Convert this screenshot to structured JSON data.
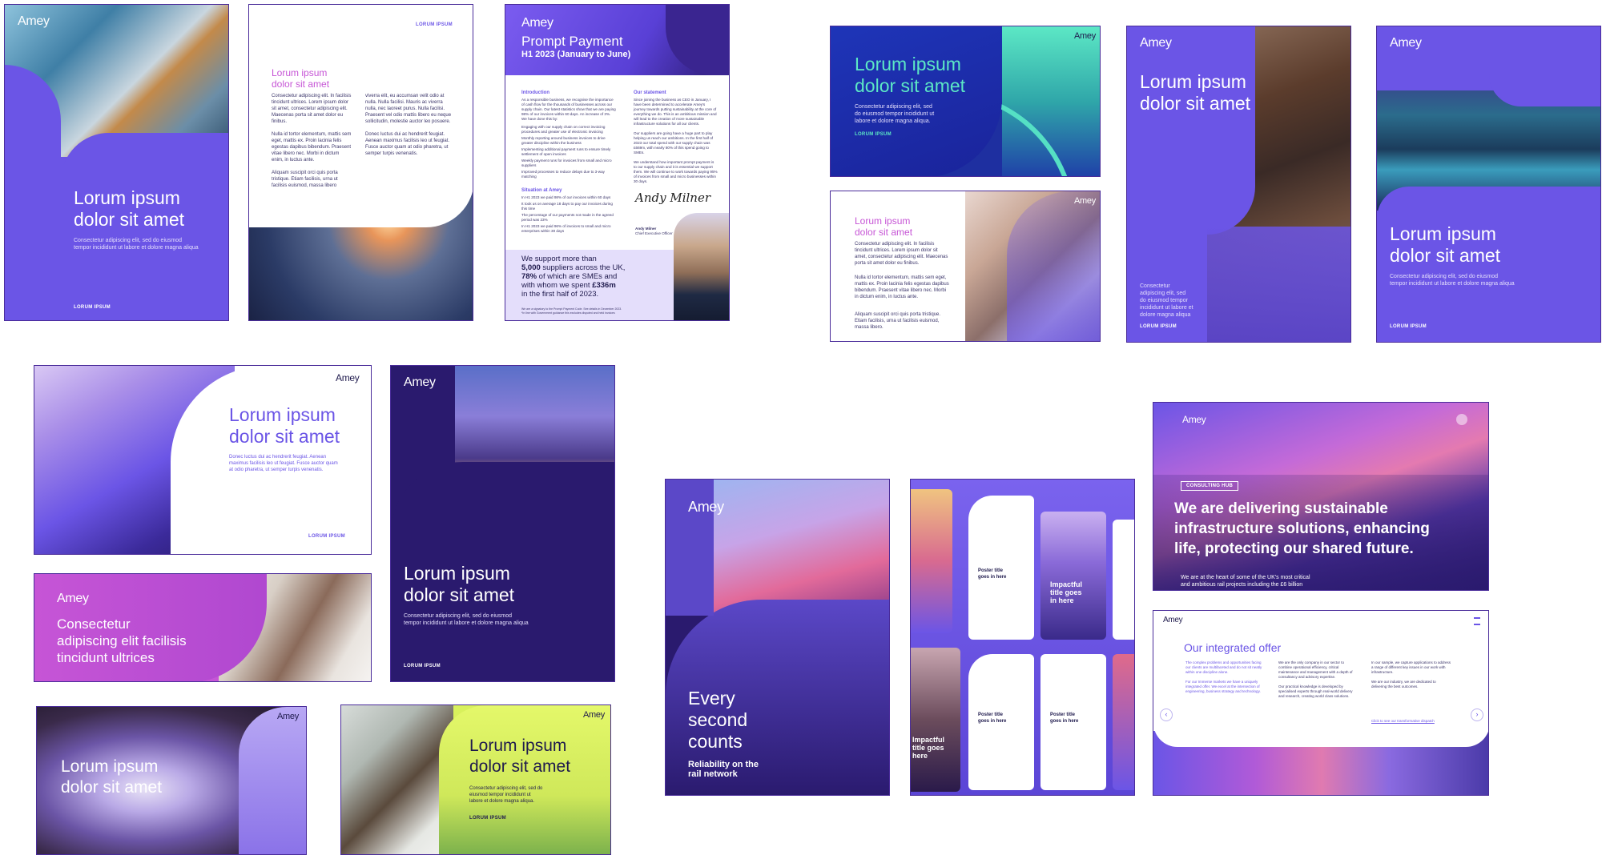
{
  "brand": "Amey",
  "cards": {
    "c1": {
      "title": "Lorum ipsum\ndolor sit amet",
      "sub": "Consectetur adipiscing elit, sed do eiusmod\ntempor incididunt ut labore et dolore magna aliqua",
      "tag": "LORUM IPSUM"
    },
    "c2": {
      "tag": "LORUM IPSUM",
      "title": "Lorum ipsum\ndolor sit amet",
      "col1": "Consectetur adipiscing elit. In facilisis tincidunt ultrices. Lorem ipsum dolor sit amet, consectetur adipiscing elit. Maecenas porta sit amet dolor eu finibus.\n\nNulla id tortor elementum, mattis sem eget, mattis ex. Proin lacinia felis egestas dapibus bibendum. Praesent vitae libero nec. Morbi in dictum enim, in luctus ante.\n\nAliquam suscipit orci quis porta tristique. Etiam facilisis, urna ut facilisis euismod, massa libero",
      "col2": "viverra elit, eu accumsan velit odio at nulla. Nulla facilisi. Mauris ac viverra nulla, nec laoreet purus. Nulla facilisi. Praesent vel odio mattis libero eu neque sollicitudin, molestie auctor leo posuere.\n\nDonec luctus dui ac hendrerit feugiat. Aenean maximus facilisis leo ut feugiat. Fusce auctor quam at odio pharetra, ut semper turpis venenatis."
    },
    "c3": {
      "title": "Prompt Payment",
      "subtitle": "H1 2023 (January to June)",
      "intro_h": "Introduction",
      "statement_h": "Our statement",
      "situation_h": "Situation at Amey",
      "intro": "As a responsible business, we recognise the importance of cash flow for the thousands of businesses across our supply chain. Our latest statistics show that we are paying 98% of our invoices within 60 days. An increase of 3%. We have done this by:",
      "bullets": [
        "Engaging with our supply chain on correct invoicing procedures and greater use of electronic invoicing",
        "Monthly reporting around business invoices to drive greater discipline within the business",
        "Implementing additional payment runs to ensure timely settlement of open invoices",
        "Weekly payment runs for invoices from small and micro suppliers",
        "Improved processes to reduce delays due to 3-way matching"
      ],
      "situation": [
        "In H1 2023 we paid 98% of our invoices within 60 days",
        "It took us on average 18 days to pay our invoices during this time",
        "The percentage of our payments not made in the agreed period was 23%",
        "In H1 2023 we paid 96% of invoices to small and micro enterprises within 30 days"
      ],
      "statement": "Since joining the business as CEO in January, I have been determined to accelerate Amey's journey towards putting sustainability at the core of everything we do. This is an ambitious mission and will lead to the creation of more sustainable infrastructure solutions for all our clients.\n\nOur suppliers are going have a huge part to play helping us reach our ambitions. In the first half of 2023 our total spend with our supply chain was £669m, with nearly 80% of this spend going to SMEs.\n\nWe understand how important prompt payment is to our supply chain and it is essential we support them. We will continue to work towards paying 95% of invoices from small and micro businesses within 30 days.",
      "signature": "Andy Milner",
      "sig_name": "Andy Milner",
      "sig_role": "Chief Executive Officer",
      "banner": [
        [
          "We support more than",
          false
        ],
        [
          "5,000",
          true
        ],
        [
          " suppliers across the UK,",
          false
        ],
        [
          "78%",
          true
        ],
        [
          " of which are SMEs and",
          false
        ],
        [
          "with whom we spent ",
          false
        ],
        [
          "£336m",
          true
        ],
        [
          "in the first half of 2023.",
          false
        ]
      ],
      "foot": "We are a signatory to the Prompt Payment Code. See details in December 2023.\n*In line with Government guidance this excludes disputed and held invoices"
    },
    "c4": {
      "title": "Lorum ipsum\ndolor sit amet",
      "sub": "Consectetur adipiscing elit, sed\ndo eiusmod tempor incididunt ut\nlabore et dolore magna aliqua.",
      "tag": "LORUM IPSUM"
    },
    "c5": {
      "title": "Lorum ipsum\ndolor sit amet",
      "p1": "Consectetur adipiscing elit. In facilisis tincidunt ultrices. Lorem ipsum dolor sit amet, consectetur adipiscing elit. Maecenas porta sit amet dolor eu finibus.",
      "p2": "Nulla id tortor elementum, mattis sem eget, mattis ex. Proin lacinia felis egestas dapibus bibendum. Praesent vitae libero nec. Morbi in dictum enim, in luctus ante.",
      "p3": "Aliquam suscipit orci quis porta tristique. Etiam facilisis, urna ut facilisis euismod, massa libero."
    },
    "c6": {
      "title": "Lorum ipsum\ndolor sit amet",
      "sub": "Consectetur\nadipiscing elit, sed\ndo eiusmod tempor\nincididunt ut labore et\ndolore magna aliqua",
      "tag": "LORUM IPSUM"
    },
    "c7": {
      "title": "Lorum ipsum\ndolor sit amet",
      "sub": "Consectetur adipiscing elit, sed do eiusmod\ntempor incididunt ut labore et dolore magna aliqua",
      "tag": "LORUM IPSUM"
    },
    "c8": {
      "title": "Lorum ipsum\ndolor sit amet",
      "sub": "Donec luctus dui ac hendrerit feugiat. Aenean\nmaximus facilisis leo ut feugiat. Fusce auctor quam\nat odio pharetra, ut semper turpis venenatis.",
      "tag": "LORUM IPSUM"
    },
    "c9": {
      "title": "Lorum ipsum\ndolor sit amet",
      "sub": "Consectetur adipiscing elit, sed do eiusmod\ntempor incididunt ut labore et dolore magna aliqua",
      "tag": "LORUM IPSUM"
    },
    "c10": {
      "title": "Consectetur\nadipiscing elit facilisis\ntincidunt ultrices"
    },
    "c11": {
      "title": "Lorum ipsum\ndolor sit amet"
    },
    "c12": {
      "title": "Lorum ipsum\ndolor sit amet",
      "sub": "Consectetur adipiscing elit, sed do\neiusmod tempor incididunt ut\nlabore et dolore magna aliqua.",
      "tag": "LORUM IPSUM"
    },
    "c13": {
      "title": "Every\nsecond\ncounts",
      "sub": "Reliability on the\nrail network"
    },
    "c14": {
      "posters": [
        "Poster title\ngoes in here",
        "Impactful\ntitle goes\nin here",
        "Poster title\ngoes in here",
        "Poster title\ngoes in here",
        "Impactful\ntitle goes\nhere"
      ]
    },
    "c15": {
      "badge": "CONSULTING HUB",
      "title": "We are delivering sustainable\ninfrastructure solutions, enhancing\nlife, protecting our shared future.",
      "sub": "We are at the heart of some of the UK's most critical\nand ambitious rail projects including the £6 billion"
    },
    "c16": {
      "title": "Our integrated offer",
      "col1": "The complex problems and opportunities facing our clients are multifaceted and do not sit neatly within one discipline alone.\n\nFor our Immerse markets we have a uniquely integrated offer. We excel at the intersection of engineering, business strategy and technology.",
      "col2": "We are the only company in our sector to combine operational efficiency, critical maintenance and management with a depth of consultancy and advisory expertise.\n\nOur practical knowledge is developed by specialised experts through real-world delivery and research, creating world class solutions.",
      "col3": "In our sample, we capture applications to address a range of different key issues in our work with infrastructure.\n\nWe are our industry, we are dedicated to delivering the best outcomes.",
      "link": "Click to see our transformative dispatch"
    }
  },
  "colors": {
    "purple": "#6b55e6",
    "deep": "#2a1a6e",
    "magenta": "#c655d6",
    "lime": "#d8f15c",
    "mint": "#4ce6c0"
  }
}
